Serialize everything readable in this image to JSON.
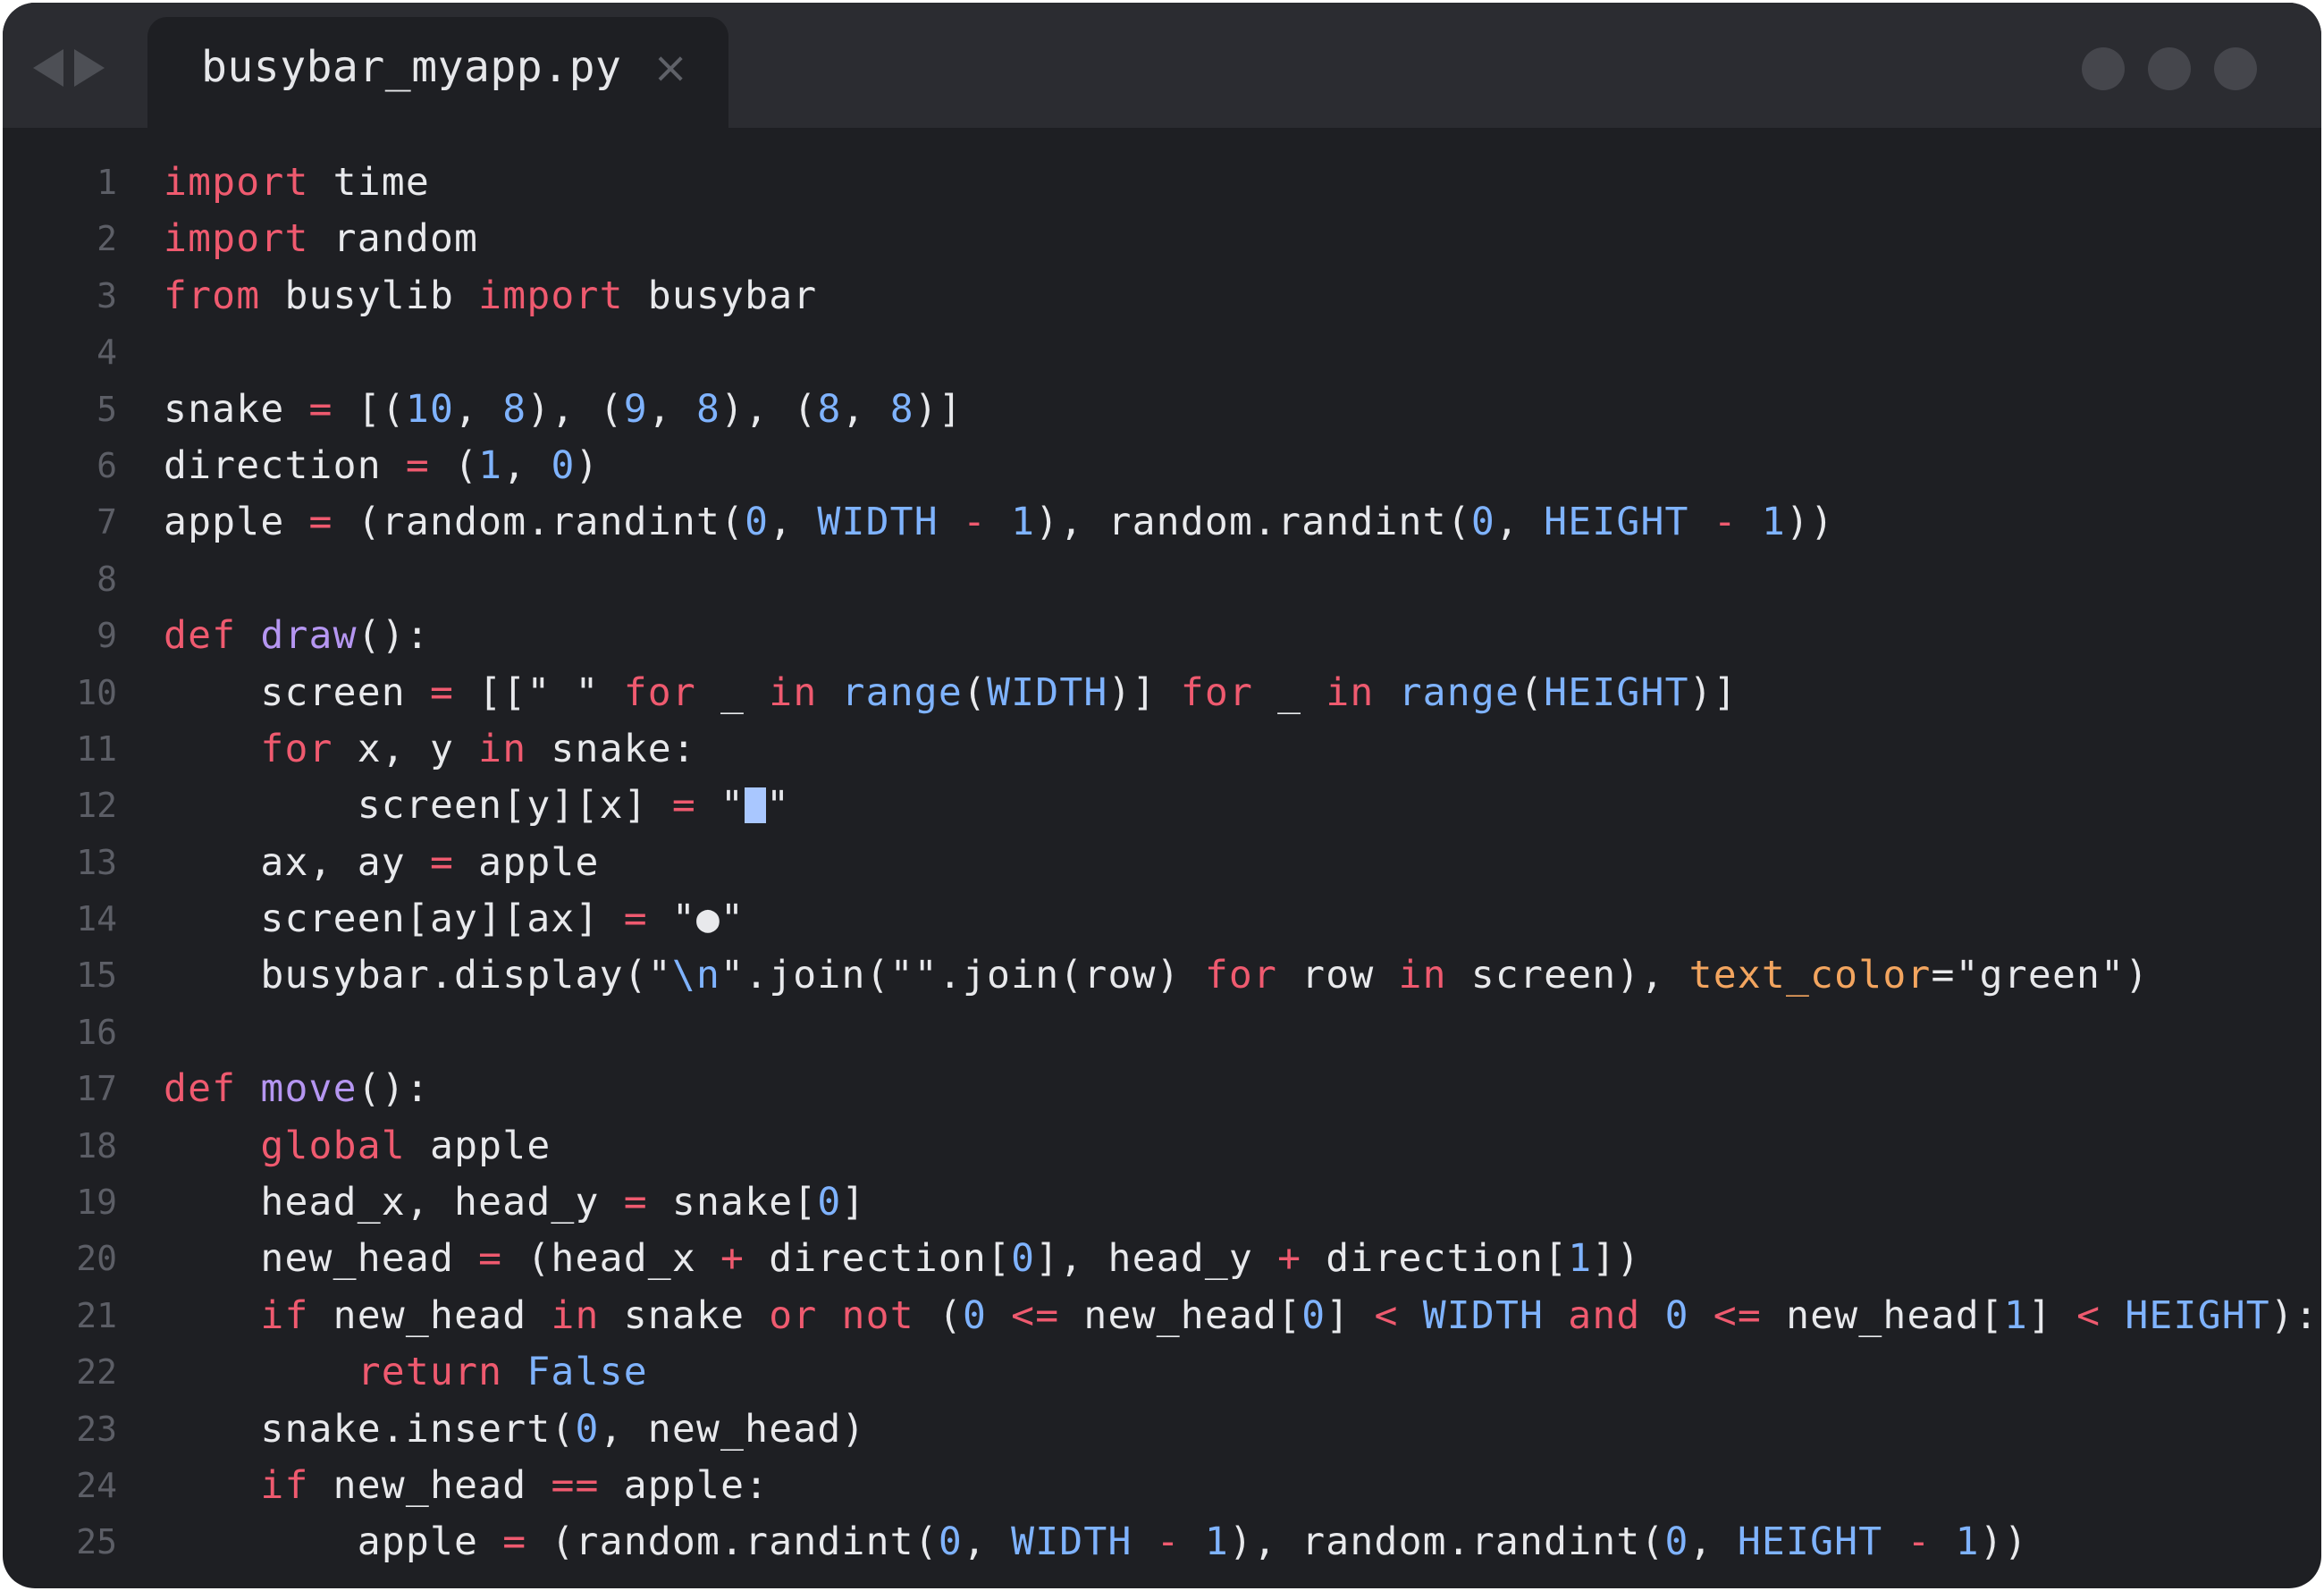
{
  "tab": {
    "title": "busybar_myapp.py",
    "close_glyph": "×"
  },
  "colors": {
    "keyword": "#ef5a6f",
    "number": "#7fb3ff",
    "function": "#b596f1",
    "kwarg": "#f3a55f",
    "text": "#e8e9ec",
    "background": "#1e1f23"
  },
  "lines": [
    {
      "n": "1",
      "segs": [
        [
          "k",
          "import"
        ],
        [
          "t",
          " time"
        ]
      ]
    },
    {
      "n": "2",
      "segs": [
        [
          "k",
          "import"
        ],
        [
          "t",
          " random"
        ]
      ]
    },
    {
      "n": "3",
      "segs": [
        [
          "k",
          "from"
        ],
        [
          "t",
          " busylib "
        ],
        [
          "k",
          "import"
        ],
        [
          "t",
          " busybar"
        ]
      ]
    },
    {
      "n": "4",
      "segs": []
    },
    {
      "n": "5",
      "segs": [
        [
          "t",
          "snake "
        ],
        [
          "k",
          "="
        ],
        [
          "t",
          " [("
        ],
        [
          "n",
          "10"
        ],
        [
          "t",
          ", "
        ],
        [
          "n",
          "8"
        ],
        [
          "t",
          "), ("
        ],
        [
          "n",
          "9"
        ],
        [
          "t",
          ", "
        ],
        [
          "n",
          "8"
        ],
        [
          "t",
          "), ("
        ],
        [
          "n",
          "8"
        ],
        [
          "t",
          ", "
        ],
        [
          "n",
          "8"
        ],
        [
          "t",
          ")]"
        ]
      ]
    },
    {
      "n": "6",
      "segs": [
        [
          "t",
          "direction "
        ],
        [
          "k",
          "="
        ],
        [
          "t",
          " ("
        ],
        [
          "n",
          "1"
        ],
        [
          "t",
          ", "
        ],
        [
          "n",
          "0"
        ],
        [
          "t",
          ")"
        ]
      ]
    },
    {
      "n": "7",
      "segs": [
        [
          "t",
          "apple "
        ],
        [
          "k",
          "="
        ],
        [
          "t",
          " (random.randint("
        ],
        [
          "n",
          "0"
        ],
        [
          "t",
          ", "
        ],
        [
          "c",
          "WIDTH"
        ],
        [
          "t",
          " "
        ],
        [
          "k",
          "-"
        ],
        [
          "t",
          " "
        ],
        [
          "n",
          "1"
        ],
        [
          "t",
          "), random.randint("
        ],
        [
          "n",
          "0"
        ],
        [
          "t",
          ", "
        ],
        [
          "c",
          "HEIGHT"
        ],
        [
          "t",
          " "
        ],
        [
          "k",
          "-"
        ],
        [
          "t",
          " "
        ],
        [
          "n",
          "1"
        ],
        [
          "t",
          "))"
        ]
      ]
    },
    {
      "n": "8",
      "segs": []
    },
    {
      "n": "9",
      "segs": [
        [
          "k",
          "def"
        ],
        [
          "t",
          " "
        ],
        [
          "f",
          "draw"
        ],
        [
          "t",
          "():"
        ]
      ]
    },
    {
      "n": "10",
      "segs": [
        [
          "t",
          "    screen "
        ],
        [
          "k",
          "="
        ],
        [
          "t",
          " [[\" \" "
        ],
        [
          "k",
          "for"
        ],
        [
          "t",
          " _ "
        ],
        [
          "k",
          "in"
        ],
        [
          "t",
          " "
        ],
        [
          "c",
          "range"
        ],
        [
          "t",
          "("
        ],
        [
          "c",
          "WIDTH"
        ],
        [
          "t",
          ")] "
        ],
        [
          "k",
          "for"
        ],
        [
          "t",
          " _ "
        ],
        [
          "k",
          "in"
        ],
        [
          "t",
          " "
        ],
        [
          "c",
          "range"
        ],
        [
          "t",
          "("
        ],
        [
          "c",
          "HEIGHT"
        ],
        [
          "t",
          ")]"
        ]
      ]
    },
    {
      "n": "11",
      "segs": [
        [
          "t",
          "    "
        ],
        [
          "k",
          "for"
        ],
        [
          "t",
          " x, y "
        ],
        [
          "k",
          "in"
        ],
        [
          "t",
          " snake:"
        ]
      ]
    },
    {
      "n": "12",
      "segs": [
        [
          "t",
          "        screen[y][x] "
        ],
        [
          "k",
          "="
        ],
        [
          "t",
          " \""
        ],
        [
          "b",
          ""
        ],
        [
          "t",
          "\""
        ]
      ]
    },
    {
      "n": "13",
      "segs": [
        [
          "t",
          "    ax, ay "
        ],
        [
          "k",
          "="
        ],
        [
          "t",
          " apple"
        ]
      ]
    },
    {
      "n": "14",
      "segs": [
        [
          "t",
          "    screen[ay][ax] "
        ],
        [
          "k",
          "="
        ],
        [
          "t",
          " \"●\""
        ]
      ]
    },
    {
      "n": "15",
      "segs": [
        [
          "t",
          "    busybar.display(\""
        ],
        [
          "c",
          "\\n"
        ],
        [
          "t",
          "\".join(\"\".join(row) "
        ],
        [
          "k",
          "for"
        ],
        [
          "t",
          " row "
        ],
        [
          "k",
          "in"
        ],
        [
          "t",
          " screen), "
        ],
        [
          "s",
          "text_color"
        ],
        [
          "t",
          "=\"green\")"
        ]
      ]
    },
    {
      "n": "16",
      "segs": []
    },
    {
      "n": "17",
      "segs": [
        [
          "k",
          "def"
        ],
        [
          "t",
          " "
        ],
        [
          "f",
          "move"
        ],
        [
          "t",
          "():"
        ]
      ]
    },
    {
      "n": "18",
      "segs": [
        [
          "t",
          "    "
        ],
        [
          "k",
          "global"
        ],
        [
          "t",
          " apple"
        ]
      ]
    },
    {
      "n": "19",
      "segs": [
        [
          "t",
          "    head_x, head_y "
        ],
        [
          "k",
          "="
        ],
        [
          "t",
          " snake["
        ],
        [
          "n",
          "0"
        ],
        [
          "t",
          "]"
        ]
      ]
    },
    {
      "n": "20",
      "segs": [
        [
          "t",
          "    new_head "
        ],
        [
          "k",
          "="
        ],
        [
          "t",
          " (head_x "
        ],
        [
          "k",
          "+"
        ],
        [
          "t",
          " direction["
        ],
        [
          "n",
          "0"
        ],
        [
          "t",
          "], head_y "
        ],
        [
          "k",
          "+"
        ],
        [
          "t",
          " direction["
        ],
        [
          "n",
          "1"
        ],
        [
          "t",
          "])"
        ]
      ]
    },
    {
      "n": "21",
      "segs": [
        [
          "t",
          "    "
        ],
        [
          "k",
          "if"
        ],
        [
          "t",
          " new_head "
        ],
        [
          "k",
          "in"
        ],
        [
          "t",
          " snake "
        ],
        [
          "k",
          "or not"
        ],
        [
          "t",
          " ("
        ],
        [
          "n",
          "0"
        ],
        [
          "t",
          " "
        ],
        [
          "k",
          "<="
        ],
        [
          "t",
          " new_head["
        ],
        [
          "n",
          "0"
        ],
        [
          "t",
          "] "
        ],
        [
          "k",
          "<"
        ],
        [
          "t",
          " "
        ],
        [
          "c",
          "WIDTH"
        ],
        [
          "t",
          " "
        ],
        [
          "k",
          "and"
        ],
        [
          "t",
          " "
        ],
        [
          "n",
          "0"
        ],
        [
          "t",
          " "
        ],
        [
          "k",
          "<="
        ],
        [
          "t",
          " new_head["
        ],
        [
          "n",
          "1"
        ],
        [
          "t",
          "] "
        ],
        [
          "k",
          "<"
        ],
        [
          "t",
          " "
        ],
        [
          "c",
          "HEIGHT"
        ],
        [
          "t",
          "):"
        ]
      ]
    },
    {
      "n": "22",
      "segs": [
        [
          "t",
          "        "
        ],
        [
          "k",
          "return"
        ],
        [
          "t",
          " "
        ],
        [
          "c",
          "False"
        ]
      ]
    },
    {
      "n": "23",
      "segs": [
        [
          "t",
          "    snake.insert("
        ],
        [
          "n",
          "0"
        ],
        [
          "t",
          ", new_head)"
        ]
      ]
    },
    {
      "n": "24",
      "segs": [
        [
          "t",
          "    "
        ],
        [
          "k",
          "if"
        ],
        [
          "t",
          " new_head "
        ],
        [
          "k",
          "=="
        ],
        [
          "t",
          " apple:"
        ]
      ]
    },
    {
      "n": "25",
      "segs": [
        [
          "t",
          "        apple "
        ],
        [
          "k",
          "="
        ],
        [
          "t",
          " (random.randint("
        ],
        [
          "n",
          "0"
        ],
        [
          "t",
          ", "
        ],
        [
          "c",
          "WIDTH"
        ],
        [
          "t",
          " "
        ],
        [
          "k",
          "-"
        ],
        [
          "t",
          " "
        ],
        [
          "n",
          "1"
        ],
        [
          "t",
          "), random.randint("
        ],
        [
          "n",
          "0"
        ],
        [
          "t",
          ", "
        ],
        [
          "c",
          "HEIGHT"
        ],
        [
          "t",
          " "
        ],
        [
          "k",
          "-"
        ],
        [
          "t",
          " "
        ],
        [
          "n",
          "1"
        ],
        [
          "t",
          "))"
        ]
      ]
    }
  ]
}
